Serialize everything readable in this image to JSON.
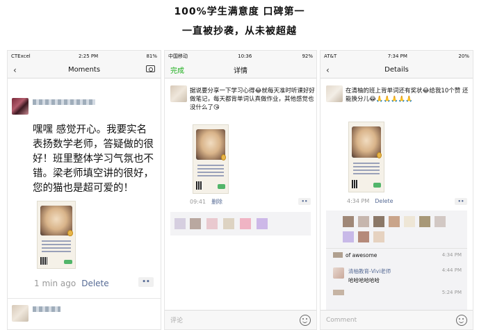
{
  "headline": {
    "line1": "100%学生满意度 口碑第一",
    "line2": "一直被抄袭，从未被超越"
  },
  "phone1": {
    "status": {
      "carrier": "CTExcel",
      "time": "2:25 PM",
      "battery": "81%"
    },
    "nav": {
      "back": "‹",
      "title": "Moments",
      "right_icon": "camera-icon"
    },
    "post_text": "嘿嘿 感觉开心。我要实名表扬数学老师，答疑做的很好！班里整体学习气氛也不错。梁老师填空讲的很好，您的猫也是超可爱的！",
    "time": "1 min ago",
    "delete": "Delete",
    "dots": "••"
  },
  "phone2": {
    "status": {
      "carrier": "中国移动",
      "time": "10:36",
      "battery": "92%"
    },
    "nav": {
      "left": "完成",
      "title": "详情"
    },
    "post_text": "据说要分享一下学习心得😂就每天准时听课好好做笔记，每天都背单词认真做作业，其他感觉也没什么了😘",
    "time": "09:41",
    "delete": "删除",
    "dots": "••",
    "comment_placeholder": "评论"
  },
  "phone3": {
    "status": {
      "carrier": "AT&T",
      "time": "7:34 PM",
      "battery": "20%"
    },
    "nav": {
      "back": "‹",
      "title": "Details"
    },
    "post_text": "在清柚的班上背单词还有奖状😂给我10个赞 还能换分儿😂🙏🙏🙏🙏🙏",
    "time": "4:34 PM",
    "delete": "Delete",
    "dots": "••",
    "comments": [
      {
        "name": "",
        "text": "of awesome",
        "time": "4:34 PM"
      },
      {
        "name": "清柚教育-Vivi老师",
        "text": "哈哈哈哈哈哈",
        "time": "4:44 PM"
      },
      {
        "name": "",
        "text": "",
        "time": "5:24 PM"
      }
    ],
    "comment_placeholder": "Comment"
  }
}
